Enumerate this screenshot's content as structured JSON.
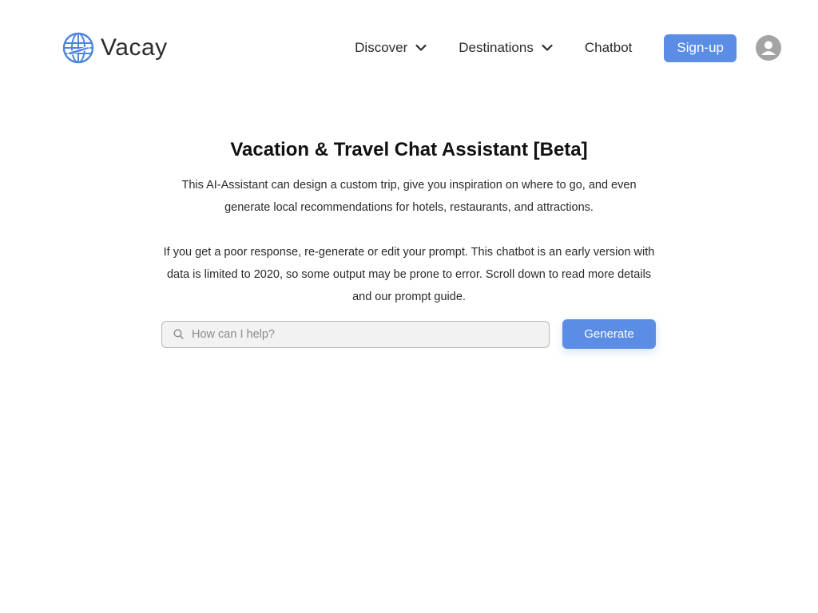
{
  "header": {
    "logo_text": "Vacay",
    "nav": {
      "discover": "Discover",
      "destinations": "Destinations",
      "chatbot": "Chatbot"
    },
    "signup_label": "Sign-up"
  },
  "main": {
    "title": "Vacation & Travel Chat Assistant [Beta]",
    "description_1": "This AI-Assistant can design a custom trip, give you inspiration on where to go, and even generate local recommendations for hotels, restaurants, and attractions.",
    "description_2": "If you get a poor response, re-generate or edit your prompt. This chatbot is an early version with data is limited to 2020, so some output may be prone to error. Scroll down to read more details and our prompt guide.",
    "search": {
      "placeholder": "How can I help?",
      "value": ""
    },
    "generate_label": "Generate"
  },
  "colors": {
    "accent": "#5b8de4",
    "avatar_bg": "#a4a4a4",
    "input_bg": "#f2f2f2"
  },
  "icons": {
    "logo": "globe-plane-icon",
    "dropdown": "chevron-down-icon",
    "search": "search-icon",
    "user": "user-avatar-icon"
  }
}
